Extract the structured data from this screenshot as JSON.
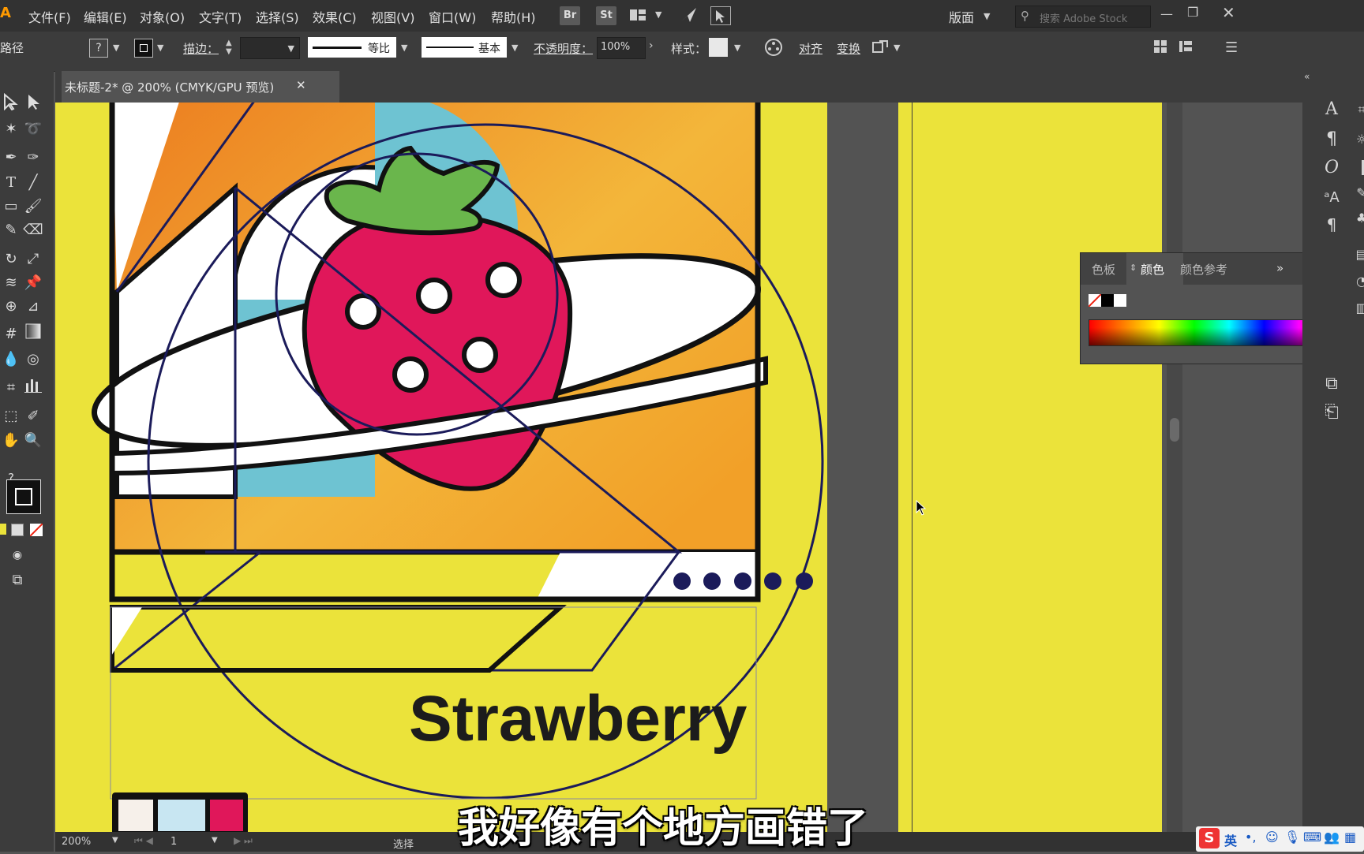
{
  "app": {
    "logo": "Ai"
  },
  "menubar": {
    "items": [
      "文件(F)",
      "编辑(E)",
      "对象(O)",
      "文字(T)",
      "选择(S)",
      "效果(C)",
      "视图(V)",
      "窗口(W)",
      "帮助(H)"
    ],
    "bridge": "Br",
    "stock": "St",
    "workspace": "版面",
    "search_placeholder": "搜索 Adobe Stock"
  },
  "controlbar": {
    "path_label": "路径",
    "stroke_label": "描边：",
    "profile_label": "等比",
    "brush_label": "基本",
    "opacity_label": "不透明度：",
    "opacity_value": "100%",
    "style_label": "样式：",
    "align_label": "对齐",
    "transform_label": "变换"
  },
  "tab": {
    "title": "未标题-2* @ 200% (CMYK/GPU 预览)"
  },
  "color_panel": {
    "tabs": [
      "色板",
      "颜色",
      "颜色参考"
    ],
    "active_tab": "颜色"
  },
  "artwork": {
    "title_text": "Strawberry"
  },
  "statusbar": {
    "zoom": "200%",
    "page": "1",
    "tool": "选择"
  },
  "subtitle": "我好像有个地方画错了",
  "ime": {
    "label": "英"
  },
  "colors": {
    "artboard": "#ebe33a",
    "orange": "#ec7c1f",
    "cyan": "#6ec3d2",
    "berry": "#e0175a",
    "leaf": "#6ab64c",
    "navy": "#1b1b5a"
  }
}
